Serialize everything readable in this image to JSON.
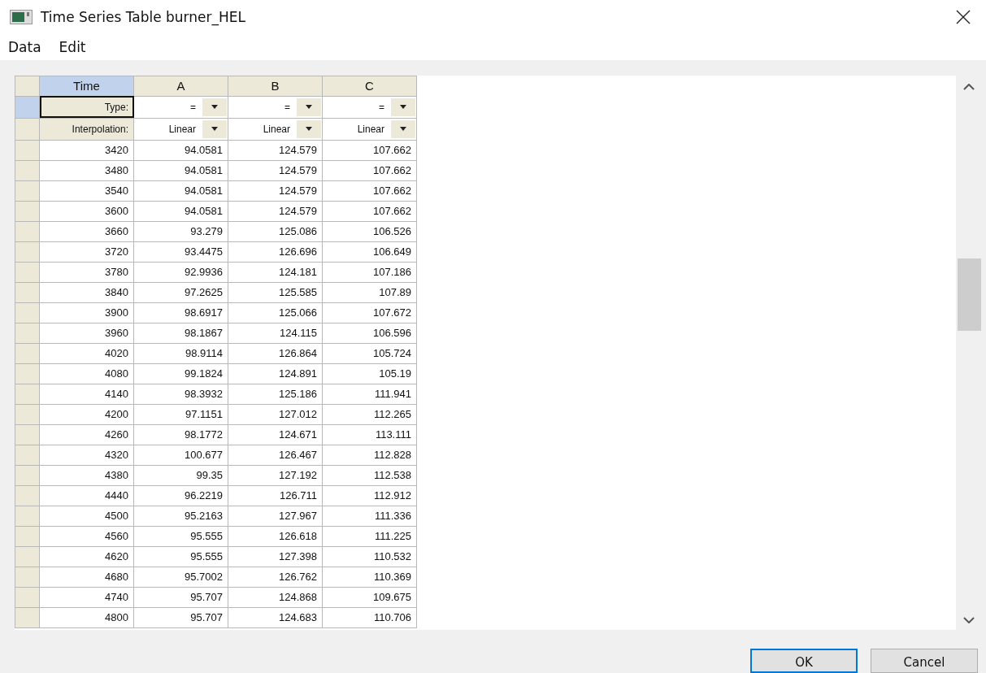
{
  "window": {
    "title": "Time Series Table burner_HEL"
  },
  "menu": [
    {
      "label": "Data"
    },
    {
      "label": "Edit"
    }
  ],
  "table": {
    "columns": [
      {
        "label": "Time",
        "selected": true
      },
      {
        "label": "A",
        "selected": false
      },
      {
        "label": "B",
        "selected": false
      },
      {
        "label": "C",
        "selected": false
      }
    ],
    "param_rows": [
      {
        "label": "Type:",
        "selected": true,
        "values": [
          "=",
          "=",
          "="
        ]
      },
      {
        "label": "Interpolation:",
        "selected": false,
        "values": [
          "Linear",
          "Linear",
          "Linear"
        ]
      }
    ],
    "rows": [
      {
        "time": "3420",
        "values": [
          "94.0581",
          "124.579",
          "107.662"
        ]
      },
      {
        "time": "3480",
        "values": [
          "94.0581",
          "124.579",
          "107.662"
        ]
      },
      {
        "time": "3540",
        "values": [
          "94.0581",
          "124.579",
          "107.662"
        ]
      },
      {
        "time": "3600",
        "values": [
          "94.0581",
          "124.579",
          "107.662"
        ]
      },
      {
        "time": "3660",
        "values": [
          "93.279",
          "125.086",
          "106.526"
        ]
      },
      {
        "time": "3720",
        "values": [
          "93.4475",
          "126.696",
          "106.649"
        ]
      },
      {
        "time": "3780",
        "values": [
          "92.9936",
          "124.181",
          "107.186"
        ]
      },
      {
        "time": "3840",
        "values": [
          "97.2625",
          "125.585",
          "107.89"
        ]
      },
      {
        "time": "3900",
        "values": [
          "98.6917",
          "125.066",
          "107.672"
        ]
      },
      {
        "time": "3960",
        "values": [
          "98.1867",
          "124.115",
          "106.596"
        ]
      },
      {
        "time": "4020",
        "values": [
          "98.9114",
          "126.864",
          "105.724"
        ]
      },
      {
        "time": "4080",
        "values": [
          "99.1824",
          "124.891",
          "105.19"
        ]
      },
      {
        "time": "4140",
        "values": [
          "98.3932",
          "125.186",
          "111.941"
        ]
      },
      {
        "time": "4200",
        "values": [
          "97.1151",
          "127.012",
          "112.265"
        ]
      },
      {
        "time": "4260",
        "values": [
          "98.1772",
          "124.671",
          "113.111"
        ]
      },
      {
        "time": "4320",
        "values": [
          "100.677",
          "126.467",
          "112.828"
        ]
      },
      {
        "time": "4380",
        "values": [
          "99.35",
          "127.192",
          "112.538"
        ]
      },
      {
        "time": "4440",
        "values": [
          "96.2219",
          "126.711",
          "112.912"
        ]
      },
      {
        "time": "4500",
        "values": [
          "95.2163",
          "127.967",
          "111.336"
        ]
      },
      {
        "time": "4560",
        "values": [
          "95.555",
          "126.618",
          "111.225"
        ]
      },
      {
        "time": "4620",
        "values": [
          "95.555",
          "127.398",
          "110.532"
        ]
      },
      {
        "time": "4680",
        "values": [
          "95.7002",
          "126.762",
          "110.369"
        ]
      },
      {
        "time": "4740",
        "values": [
          "95.707",
          "124.868",
          "109.675"
        ]
      },
      {
        "time": "4800",
        "values": [
          "95.707",
          "124.683",
          "110.706"
        ]
      }
    ]
  },
  "buttons": [
    {
      "label": "OK",
      "kind": "default"
    },
    {
      "label": "Cancel",
      "kind": "normal"
    }
  ]
}
